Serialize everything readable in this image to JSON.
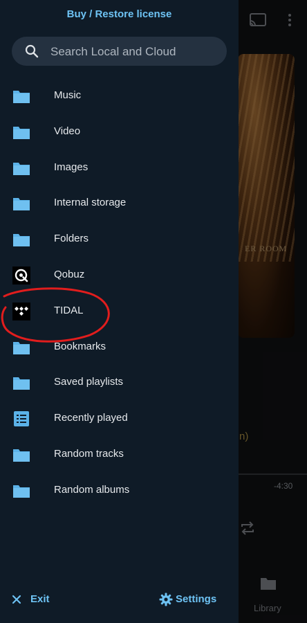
{
  "drawer": {
    "buy_label": "Buy / Restore license",
    "search_placeholder": "Search Local and Cloud",
    "items": [
      {
        "label": "Music",
        "icon": "folder-icon"
      },
      {
        "label": "Video",
        "icon": "folder-icon"
      },
      {
        "label": "Images",
        "icon": "folder-icon"
      },
      {
        "label": "Internal storage",
        "icon": "folder-icon"
      },
      {
        "label": "Folders",
        "icon": "folder-icon"
      },
      {
        "label": "Qobuz",
        "icon": "qobuz-icon"
      },
      {
        "label": "TIDAL",
        "icon": "tidal-icon"
      },
      {
        "label": "Bookmarks",
        "icon": "folder-icon"
      },
      {
        "label": "Saved playlists",
        "icon": "folder-icon"
      },
      {
        "label": "Recently played",
        "icon": "list-icon"
      },
      {
        "label": "Random tracks",
        "icon": "folder-icon"
      },
      {
        "label": "Random albums",
        "icon": "folder-icon"
      }
    ],
    "exit_label": "Exit",
    "settings_label": "Settings"
  },
  "background": {
    "album_text": "ER ROOM",
    "partial_text": "n)",
    "remaining_time": "-4:30",
    "library_label": "Library"
  },
  "colors": {
    "drawer_bg": "#0f1b27",
    "accent": "#6ec3f4",
    "folder": "#5bb2e8",
    "annotation": "#e11d1d"
  }
}
